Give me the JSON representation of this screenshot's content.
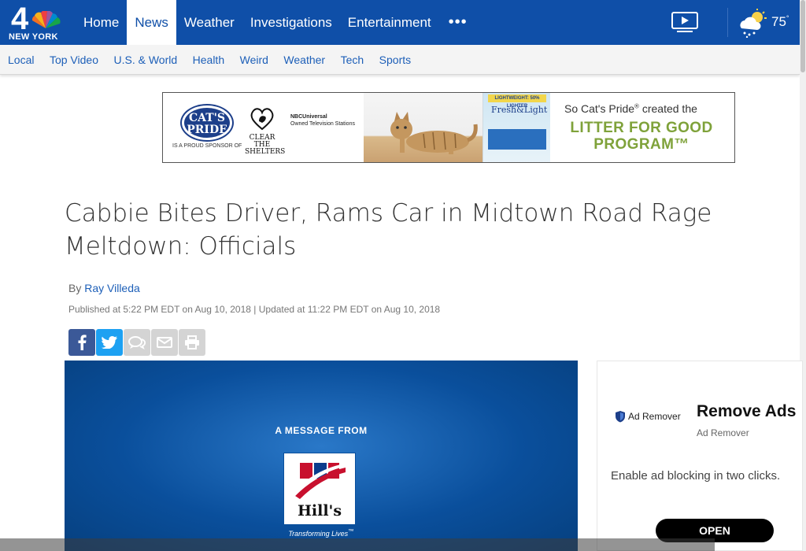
{
  "brand": {
    "logo_text": "NEW YORK",
    "logo_number": "4"
  },
  "main_nav": [
    {
      "label": "Home",
      "active": false
    },
    {
      "label": "News",
      "active": true
    },
    {
      "label": "Weather",
      "active": false
    },
    {
      "label": "Investigations",
      "active": false
    },
    {
      "label": "Entertainment",
      "active": false
    }
  ],
  "more_label": "•••",
  "weather": {
    "temp": "75",
    "unit": "°"
  },
  "sub_nav": [
    "Local",
    "Top Video",
    "U.S. & World",
    "Health",
    "Weird",
    "Weather",
    "Tech",
    "Sports"
  ],
  "banner_ad": {
    "brand_logo": "CAT'S PRIDE",
    "sponsor_text": "IS A PROUD SPONSOR OF",
    "cts_text": "CLEAR THE SHELTERS",
    "nbcu_title": "NBCUniversal",
    "nbcu_sub": "Owned Television Stations",
    "litter_tag": "LIGHTWEIGHT: 50% LIGHTER",
    "litter_brand": "Fresh&Light",
    "headline": "So Cat's Pride",
    "headline_rest": " created the",
    "big_text": "LITTER FOR GOOD PROGRAM™"
  },
  "article": {
    "headline": "Cabbie Bites Driver, Rams Car in Midtown Road Rage Meltdown: Officials",
    "by_prefix": "By",
    "author": "Ray Villeda",
    "published": "Published at 5:22 PM EDT on Aug 10, 2018 | Updated at 11:22 PM EDT on Aug 10, 2018"
  },
  "video": {
    "message_from": "A MESSAGE FROM",
    "brand": "Hill's",
    "tagline": "Transforming Lives"
  },
  "side_ad": {
    "small_label": "Ad Remover",
    "title": "Remove Ads",
    "subtitle": "Ad Remover",
    "description": "Enable ad blocking in two clicks.",
    "button": "OPEN"
  }
}
